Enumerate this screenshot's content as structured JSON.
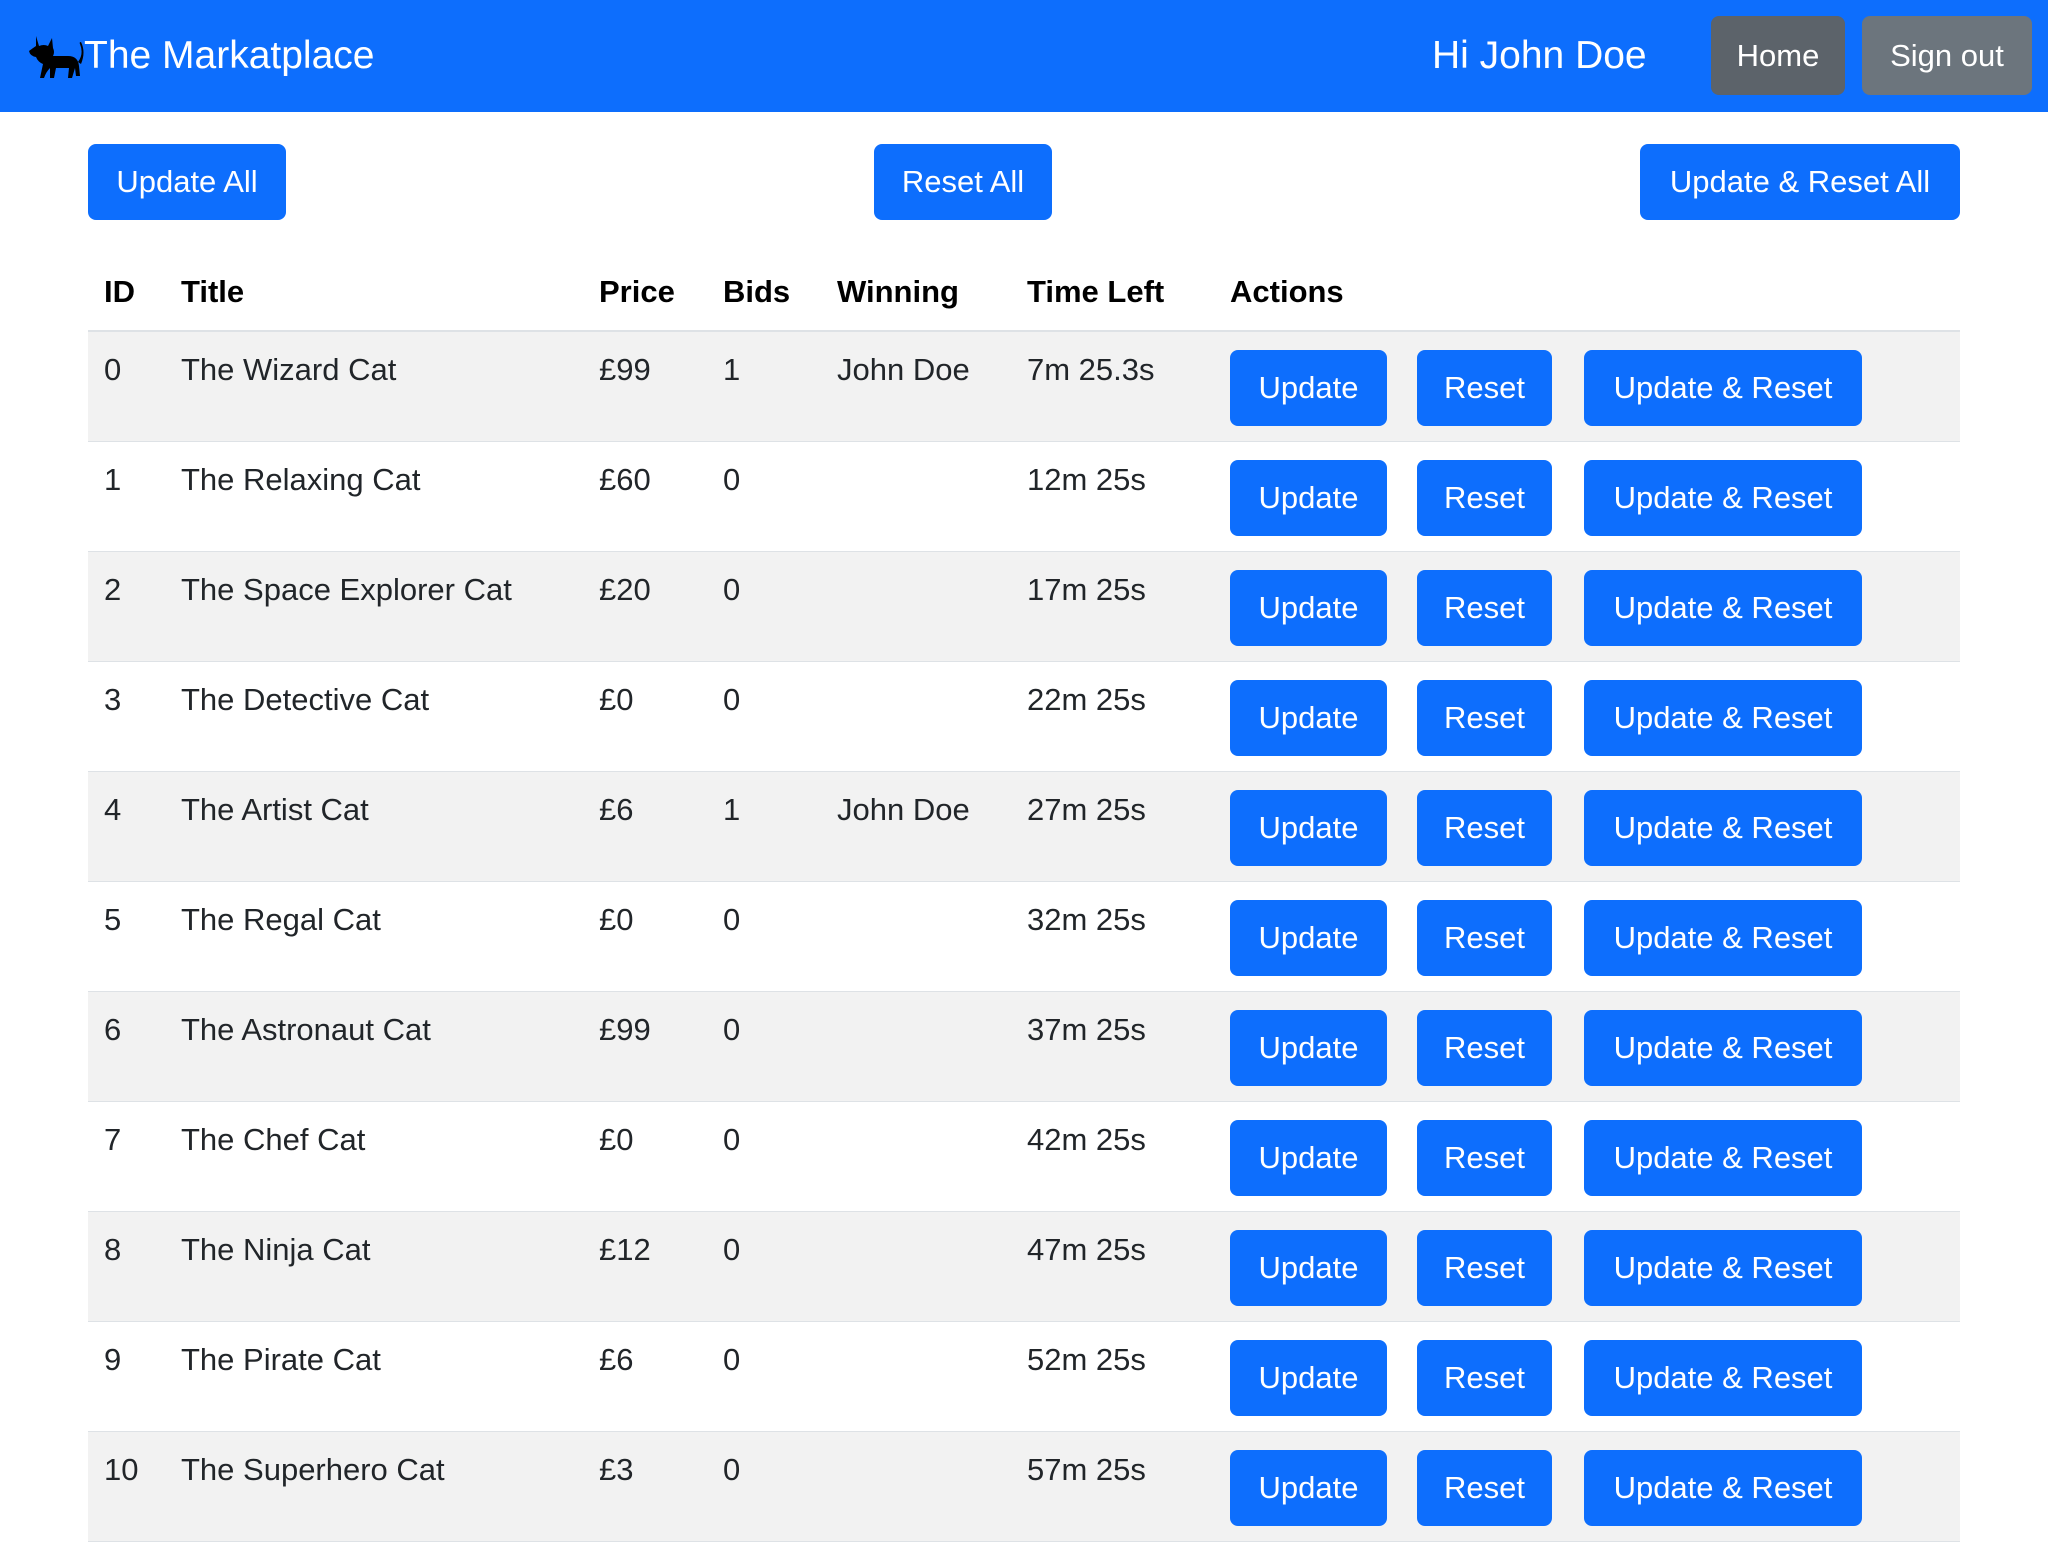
{
  "navbar": {
    "brand": "The Markatplace",
    "greeting": "Hi John Doe",
    "home_label": "Home",
    "signout_label": "Sign out",
    "brand_color": "#0d6efd"
  },
  "toolbar": {
    "update_all": "Update All",
    "reset_all": "Reset All",
    "update_reset_all": "Update & Reset All"
  },
  "table": {
    "headers": [
      "ID",
      "Title",
      "Price",
      "Bids",
      "Winning",
      "Time Left",
      "Actions"
    ],
    "action_labels": {
      "update": "Update",
      "reset": "Reset",
      "update_reset": "Update & Reset"
    },
    "rows": [
      {
        "id": "0",
        "title": "The Wizard Cat",
        "price": "£99",
        "bids": "1",
        "winning": "John Doe",
        "time_left": "7m 25.3s"
      },
      {
        "id": "1",
        "title": "The Relaxing Cat",
        "price": "£60",
        "bids": "0",
        "winning": "",
        "time_left": "12m 25s"
      },
      {
        "id": "2",
        "title": "The Space Explorer Cat",
        "price": "£20",
        "bids": "0",
        "winning": "",
        "time_left": "17m 25s"
      },
      {
        "id": "3",
        "title": "The Detective Cat",
        "price": "£0",
        "bids": "0",
        "winning": "",
        "time_left": "22m 25s"
      },
      {
        "id": "4",
        "title": "The Artist Cat",
        "price": "£6",
        "bids": "1",
        "winning": "John Doe",
        "time_left": "27m 25s"
      },
      {
        "id": "5",
        "title": "The Regal Cat",
        "price": "£0",
        "bids": "0",
        "winning": "",
        "time_left": "32m 25s"
      },
      {
        "id": "6",
        "title": "The Astronaut Cat",
        "price": "£99",
        "bids": "0",
        "winning": "",
        "time_left": "37m 25s"
      },
      {
        "id": "7",
        "title": "The Chef Cat",
        "price": "£0",
        "bids": "0",
        "winning": "",
        "time_left": "42m 25s"
      },
      {
        "id": "8",
        "title": "The Ninja Cat",
        "price": "£12",
        "bids": "0",
        "winning": "",
        "time_left": "47m 25s"
      },
      {
        "id": "9",
        "title": "The Pirate Cat",
        "price": "£6",
        "bids": "0",
        "winning": "",
        "time_left": "52m 25s"
      },
      {
        "id": "10",
        "title": "The Superhero Cat",
        "price": "£3",
        "bids": "0",
        "winning": "",
        "time_left": "57m 25s"
      }
    ]
  }
}
